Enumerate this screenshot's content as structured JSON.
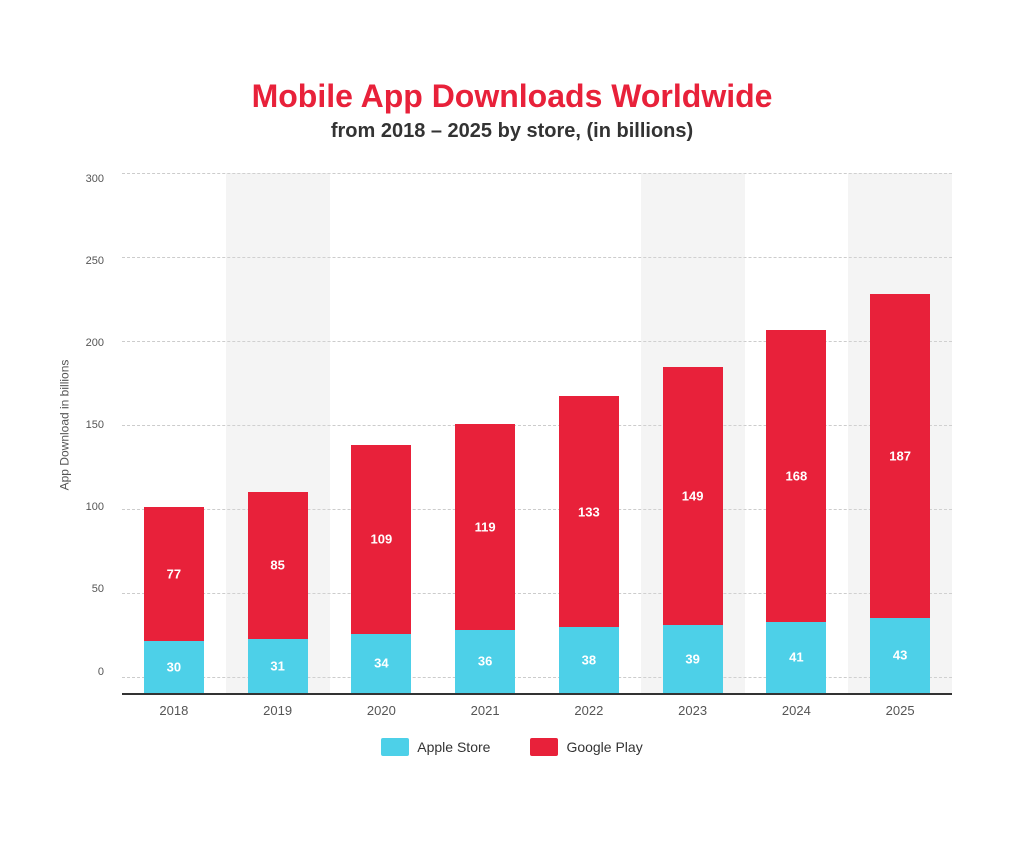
{
  "title": {
    "main": "Mobile App Downloads Worldwide",
    "sub": "from 2018 – 2025 by store, (in billions)"
  },
  "yAxis": {
    "title": "App Download in billions",
    "labels": [
      "300",
      "250",
      "200",
      "150",
      "100",
      "50",
      "0"
    ]
  },
  "bars": [
    {
      "year": "2018",
      "apple": 30,
      "google": 77,
      "shaded": false
    },
    {
      "year": "2019",
      "apple": 31,
      "google": 85,
      "shaded": true
    },
    {
      "year": "2020",
      "apple": 34,
      "google": 109,
      "shaded": false
    },
    {
      "year": "2021",
      "apple": 36,
      "google": 119,
      "shaded": false
    },
    {
      "year": "2022",
      "apple": 38,
      "google": 133,
      "shaded": false
    },
    {
      "year": "2023",
      "apple": 39,
      "google": 149,
      "shaded": true
    },
    {
      "year": "2024",
      "apple": 41,
      "google": 168,
      "shaded": false
    },
    {
      "year": "2025",
      "apple": 43,
      "google": 187,
      "shaded": true
    }
  ],
  "legend": {
    "apple_label": "Apple Store",
    "google_label": "Google Play",
    "apple_color": "#4dd0e8",
    "google_color": "#e8213a"
  },
  "maxValue": 300,
  "chartHeight": 520
}
